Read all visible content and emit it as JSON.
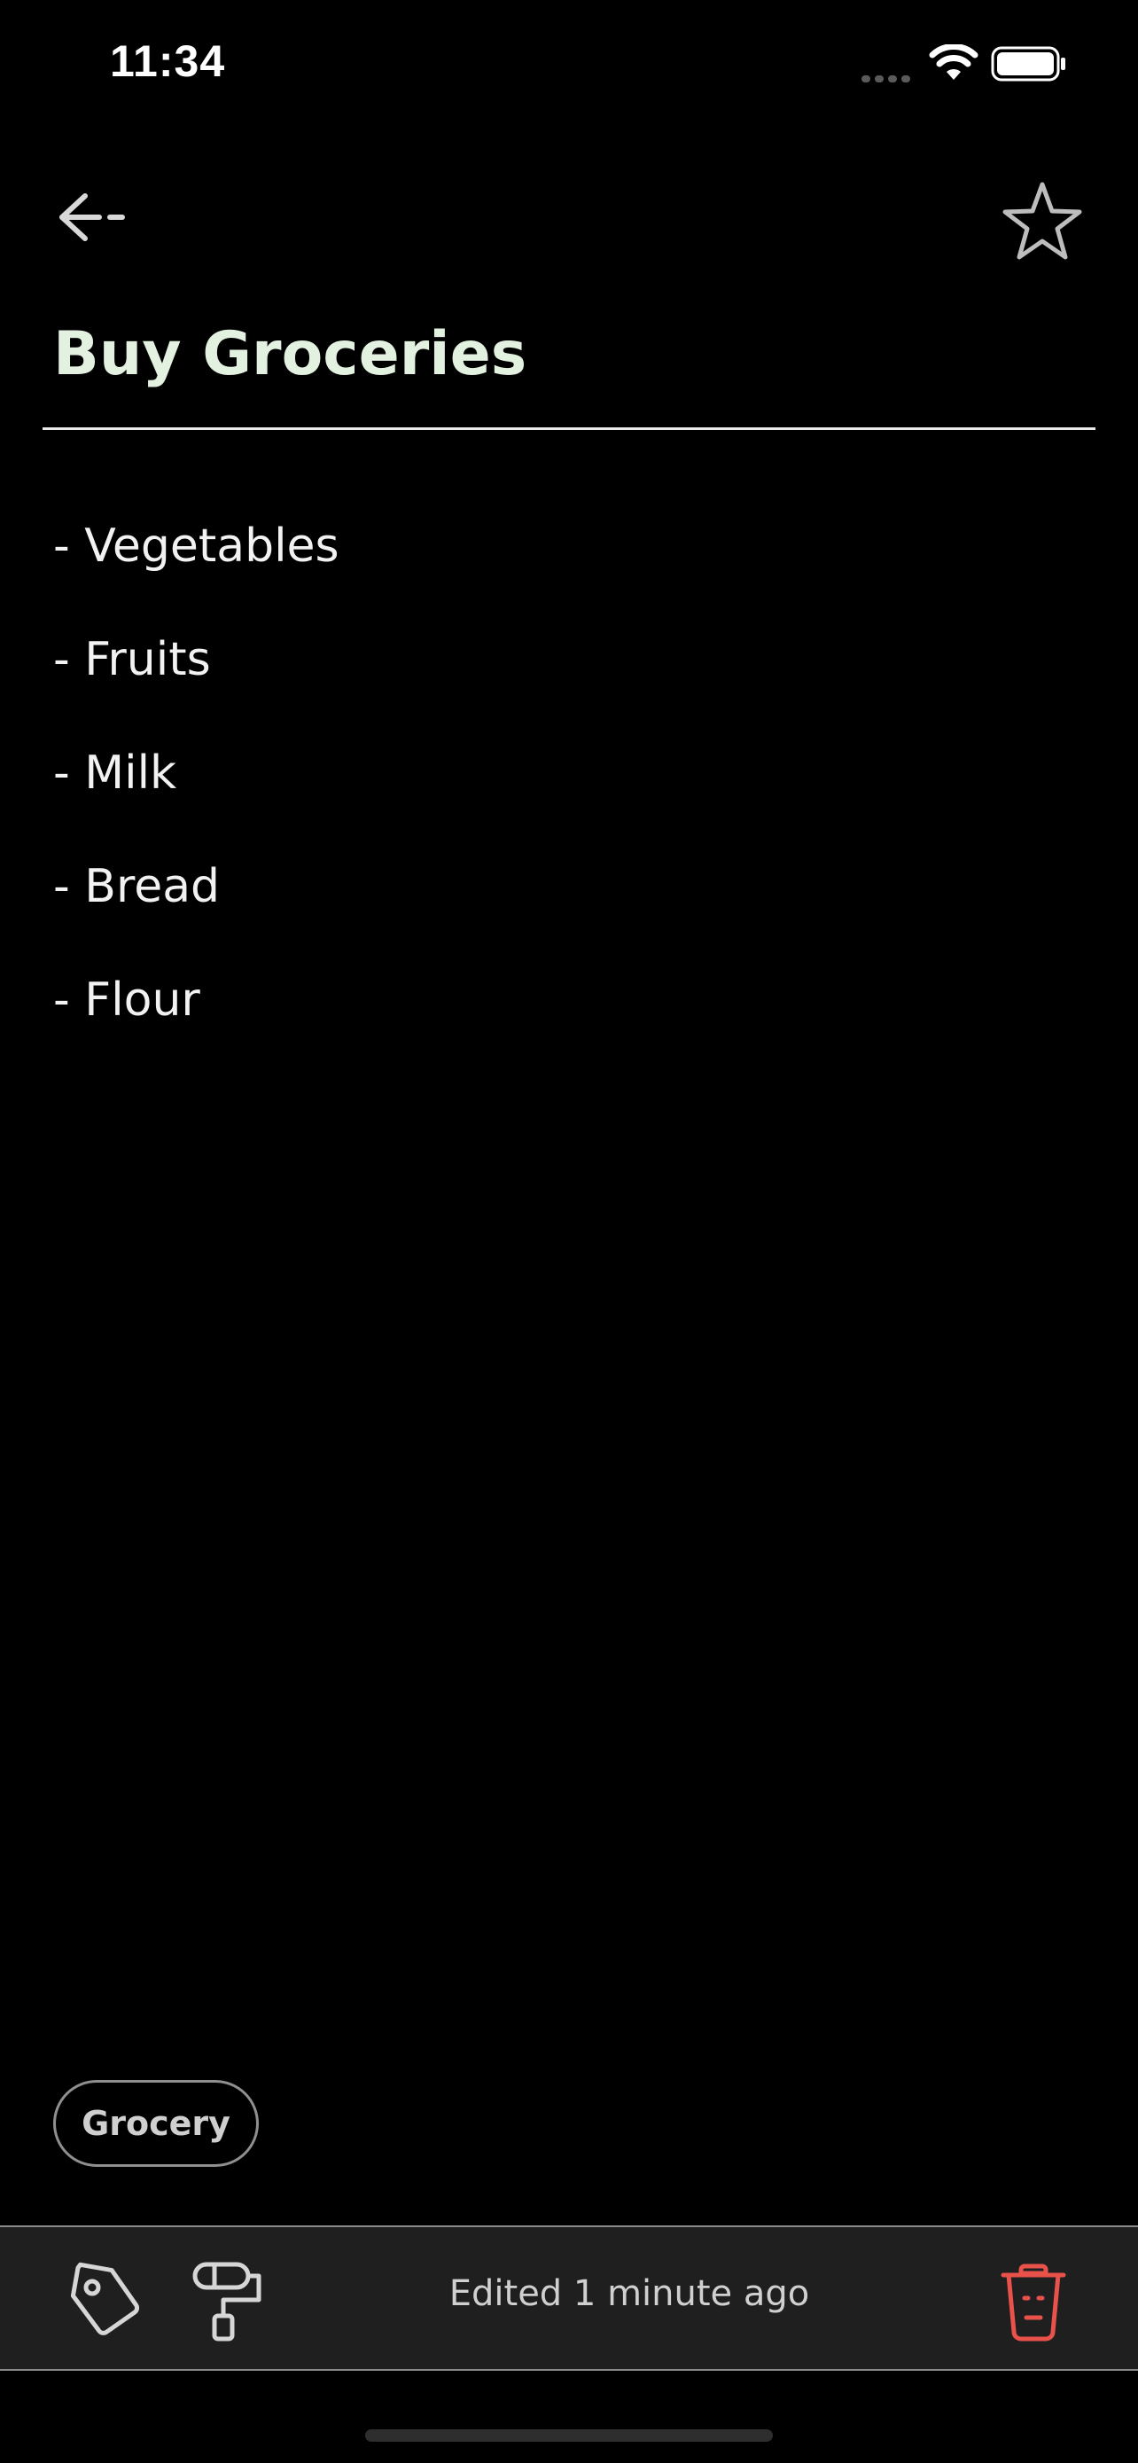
{
  "status_bar": {
    "time": "11:34"
  },
  "header": {
    "back_icon": "back-arrow-icon",
    "favorite_icon": "star-outline-icon"
  },
  "note": {
    "title": "Buy Groceries",
    "body_lines": [
      "- Vegetables",
      "- Fruits",
      "- Milk",
      "- Bread",
      "- Flour"
    ]
  },
  "tags": [
    {
      "label": "Grocery"
    }
  ],
  "toolbar": {
    "tag_icon": "tag-icon",
    "theme_icon": "paint-roller-icon",
    "edited_text": "Edited 1 minute ago",
    "delete_icon": "trash-icon",
    "delete_color": "#e8524b"
  },
  "colors": {
    "background": "#000000",
    "title": "#e3f1e0",
    "toolbar_background": "#1f1f1f"
  }
}
